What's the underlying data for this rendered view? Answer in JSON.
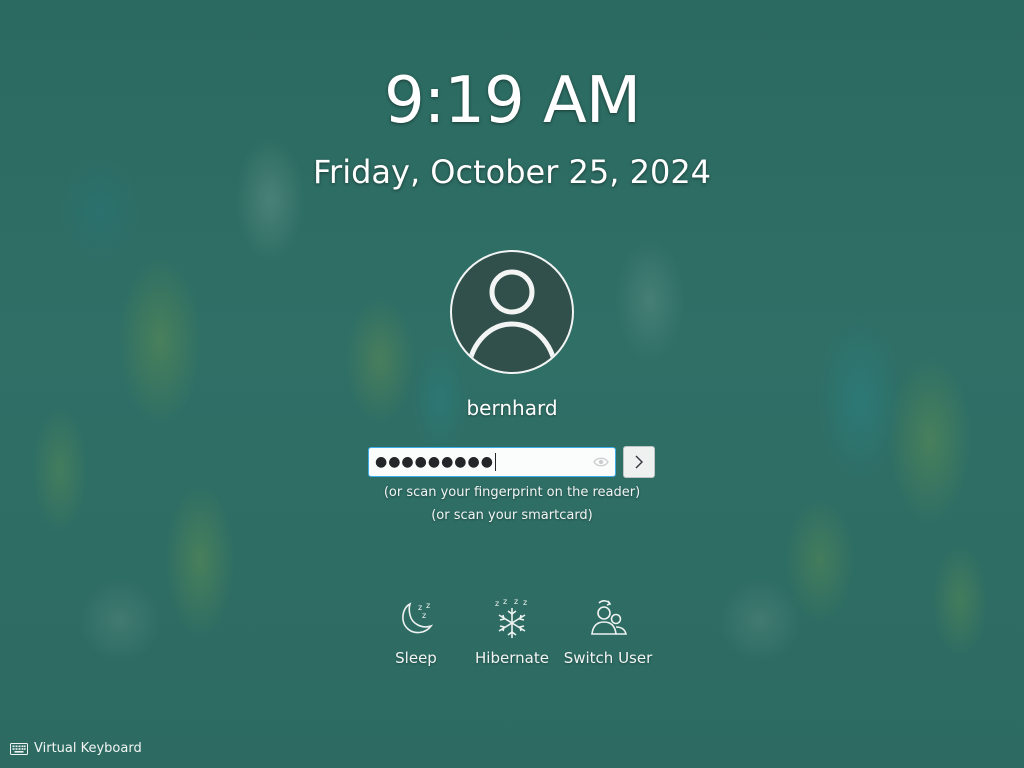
{
  "lockscreen": {
    "time": "9:19 AM",
    "date": "Friday, October 25, 2024"
  },
  "user": {
    "name": "bernhard",
    "avatar_icon": "user-avatar-icon"
  },
  "password": {
    "masked_value": "●●●●●●●●●",
    "reveal_icon": "eye-icon",
    "login_icon": "chevron-right-icon"
  },
  "hints": {
    "fingerprint": "(or scan your fingerprint on the reader)",
    "smartcard": "(or scan your smartcard)"
  },
  "actions": [
    {
      "label": "Sleep",
      "icon": "sleep-moon-icon"
    },
    {
      "label": "Hibernate",
      "icon": "snowflake-icon"
    },
    {
      "label": "Switch User",
      "icon": "switch-user-icon"
    }
  ],
  "footer": {
    "virtual_keyboard_label": "Virtual Keyboard",
    "icon": "keyboard-icon"
  },
  "colors": {
    "background": "#2e6a62",
    "focus_accent": "#3daee9",
    "avatar_bg": "#31504c"
  }
}
